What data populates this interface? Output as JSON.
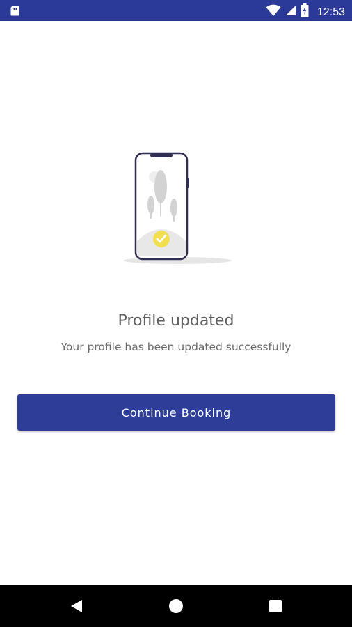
{
  "status_bar": {
    "time": "12:53",
    "icons": [
      "sim-card-icon",
      "wifi-icon",
      "signal-icon",
      "battery-charging-icon"
    ],
    "color": "#2b3a97"
  },
  "main": {
    "illustration": "phone-check-illustration",
    "title": "Profile updated",
    "subtitle": "Your profile has been updated successfully",
    "continue_label": "Continue Booking",
    "accent": "#2e3d98"
  },
  "nav_bar": {
    "icons": [
      "back-icon",
      "home-icon",
      "recent-apps-icon"
    ]
  }
}
